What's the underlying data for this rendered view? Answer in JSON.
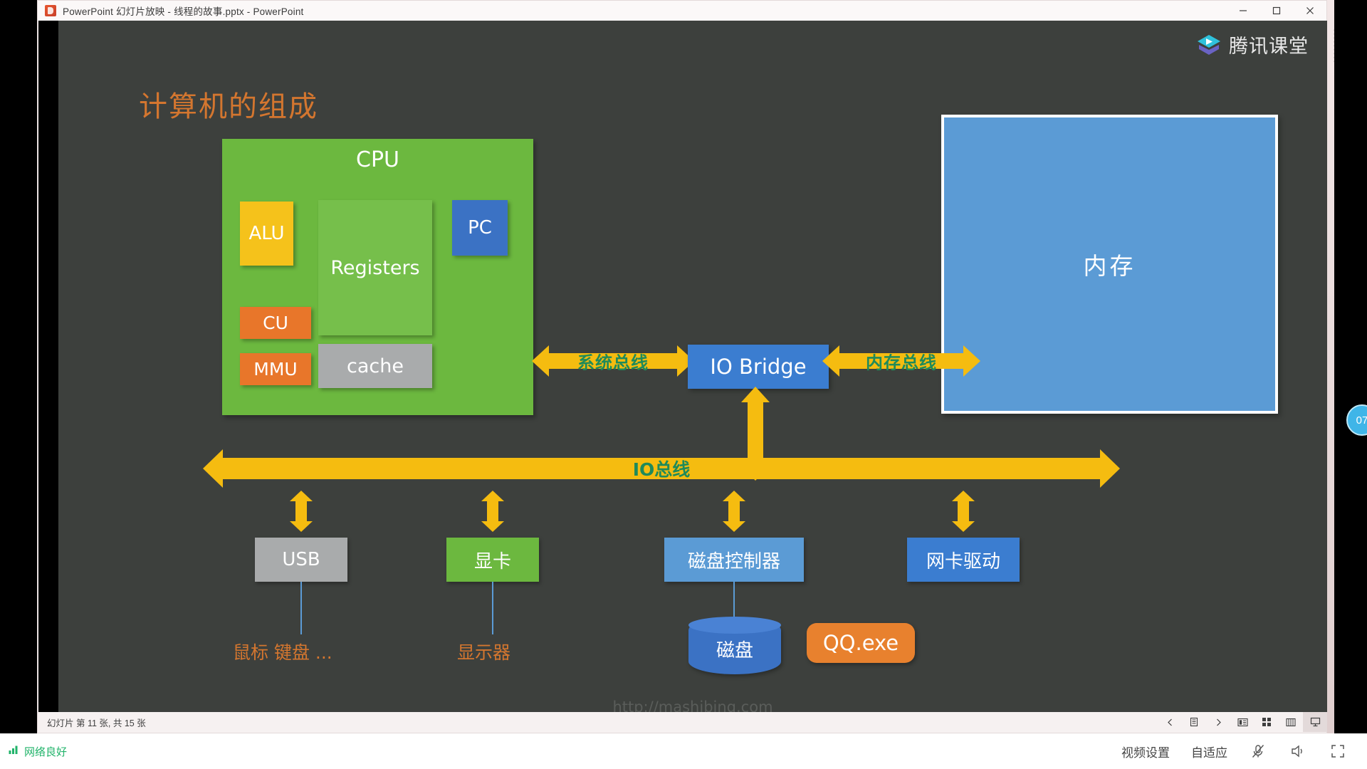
{
  "window": {
    "title": "PowerPoint 幻灯片放映  -  线程的故事.pptx - PowerPoint",
    "app_icon": "powerpoint-icon",
    "controls": {
      "minimize": "minimize-icon",
      "maximize": "maximize-icon",
      "close": "close-icon"
    }
  },
  "slide": {
    "brand": {
      "name": "腾讯课堂",
      "icon": "tencent-classroom-logo"
    },
    "title": "计算机的组成",
    "watermark": "http://mashibing.com",
    "cpu": {
      "label": "CPU",
      "parts": [
        {
          "id": "alu",
          "label": "ALU",
          "color": "#f5c21b"
        },
        {
          "id": "regs",
          "label": "Registers",
          "color": "#76bf4b"
        },
        {
          "id": "pc",
          "label": "PC",
          "color": "#3b72c4"
        },
        {
          "id": "cu",
          "label": "CU",
          "color": "#e8762a"
        },
        {
          "id": "mmu",
          "label": "MMU",
          "color": "#e8762a"
        },
        {
          "id": "cache",
          "label": "cache",
          "color": "#a9abac"
        }
      ]
    },
    "memory": {
      "label": "内存",
      "color": "#5b9bd5"
    },
    "io_bridge": {
      "label": "IO Bridge",
      "color": "#3b7dd0"
    },
    "buses": {
      "system_bus": "系统总线",
      "memory_bus": "内存总线",
      "io_bus": "IO总线",
      "bus_color": "#f5bc10",
      "bus_label_color": "#1f8a5a"
    },
    "devices": [
      {
        "id": "usb",
        "label": "USB",
        "color": "#a9abac",
        "caption": "鼠标 键盘 ..."
      },
      {
        "id": "gpu",
        "label": "显卡",
        "color": "#6cb83f",
        "caption": "显示器"
      },
      {
        "id": "disk_ctrl",
        "label": "磁盘控制器",
        "color": "#5b9bd5",
        "caption": ""
      },
      {
        "id": "nic",
        "label": "网卡驱动",
        "color": "#3b7dd0",
        "caption": ""
      }
    ],
    "disk": {
      "label": "磁盘",
      "color": "#3b72c4"
    },
    "process": {
      "label": "QQ.exe",
      "color": "#e8812e"
    }
  },
  "status_bar": {
    "slide_counter": "幻灯片 第 11 张, 共 15 张",
    "tools": [
      {
        "name": "previous-slide-button",
        "icon": "chevron-left-icon"
      },
      {
        "name": "pen-tools-button",
        "icon": "pen-icon"
      },
      {
        "name": "next-slide-button",
        "icon": "chevron-right-icon"
      },
      {
        "name": "reading-view-button",
        "icon": "reading-view-icon"
      },
      {
        "name": "slide-sorter-button",
        "icon": "grid-icon"
      },
      {
        "name": "notes-view-button",
        "icon": "notes-icon"
      },
      {
        "name": "slideshow-button",
        "icon": "projector-icon"
      }
    ]
  },
  "right_panel": {
    "badge": "07"
  },
  "bottom_bar": {
    "network": {
      "label": "网络良好",
      "icon": "signal-bars-icon",
      "color": "#21b36a"
    },
    "video_settings": "视频设置",
    "display_mode": "自适应",
    "mic": {
      "icon": "mic-muted-icon"
    },
    "speaker": {
      "icon": "speaker-icon"
    },
    "fullscreen": {
      "icon": "fullscreen-icon"
    }
  }
}
